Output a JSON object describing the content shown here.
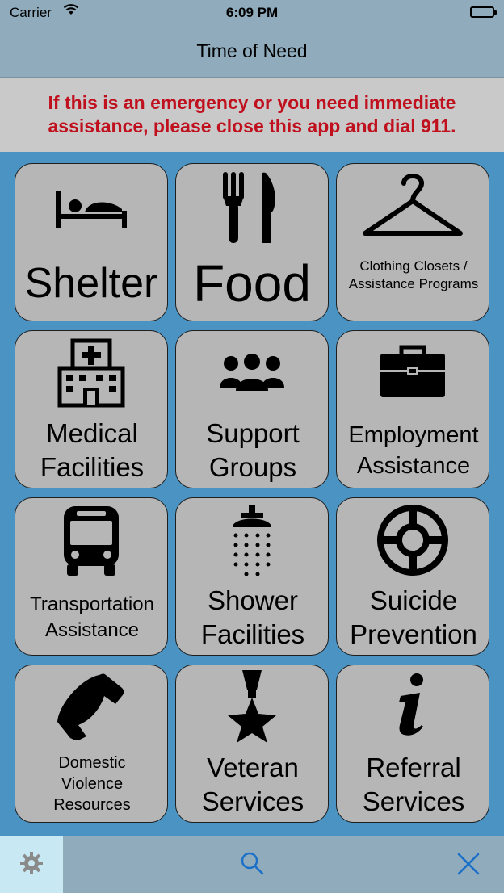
{
  "status_bar": {
    "carrier": "Carrier",
    "time": "6:09 PM"
  },
  "nav": {
    "title": "Time of Need"
  },
  "banner": {
    "text": "If this is an emergency or you need immediate assistance, please close this app and dial 911."
  },
  "tiles": [
    {
      "label": "Shelter",
      "icon": "bed-icon"
    },
    {
      "label": "Food",
      "icon": "fork-knife-icon"
    },
    {
      "label": "Clothing Closets / Assistance Programs",
      "icon": "hanger-icon"
    },
    {
      "label": "Medical Facilities",
      "icon": "hospital-icon"
    },
    {
      "label": "Support Groups",
      "icon": "group-icon"
    },
    {
      "label": "Employment Assistance",
      "icon": "briefcase-icon"
    },
    {
      "label": "Transportation Assistance",
      "icon": "bus-icon"
    },
    {
      "label": "Shower Facilities",
      "icon": "shower-icon"
    },
    {
      "label": "Suicide Prevention",
      "icon": "lifebuoy-icon"
    },
    {
      "label": "Domestic Violence Resources",
      "icon": "phone-icon"
    },
    {
      "label": "Veteran Services",
      "icon": "medal-icon"
    },
    {
      "label": "Referral Services",
      "icon": "info-icon"
    }
  ],
  "toolbar": {
    "settings": "gear-icon",
    "search": "search-icon",
    "close": "close-icon"
  },
  "colors": {
    "background": "#4a93c2",
    "bars": "#8fabbc",
    "banner_text": "#c0101d",
    "tile": "#b6b6b6",
    "accent": "#1a6fc9"
  }
}
